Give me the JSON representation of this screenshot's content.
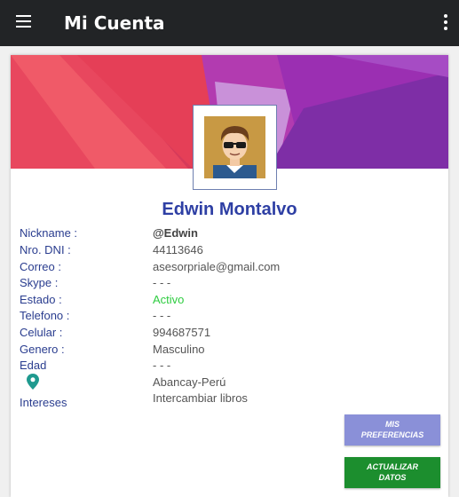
{
  "appbar": {
    "title": "Mi Cuenta",
    "menu_icon": "hamburger-menu-icon",
    "overflow_icon": "more-vertical-icon"
  },
  "profile": {
    "name": "Edwin Montalvo",
    "name_color": "#2e3fa4"
  },
  "fields": [
    {
      "label": "Nickname :",
      "value": "@Edwin"
    },
    {
      "label": "Nro. DNI :",
      "value": "44113646"
    },
    {
      "label": "Correo :",
      "value": "asesorpriale@gmail.com"
    },
    {
      "label": "Skype :",
      "value": "- - -"
    },
    {
      "label": "Estado :",
      "value": "Activo"
    },
    {
      "label": "Telefono :",
      "value": "- - -"
    },
    {
      "label": "Celular :",
      "value": "994687571"
    },
    {
      "label": "Genero :",
      "value": "Masculino"
    },
    {
      "label": "Edad",
      "value": "- - -"
    },
    {
      "label": "",
      "value": "Abancay-Perú",
      "icon": "location-pin-icon"
    },
    {
      "label": "Intereses",
      "value": "Intercambiar libros"
    }
  ],
  "buttons": {
    "preferences": {
      "line1": "MIS",
      "line2": "PREFERENCIAS",
      "color": "#8a90d8"
    },
    "update": {
      "line1": "ACTUALIZAR",
      "line2": "DATOS",
      "color": "#1c8e2e"
    }
  },
  "colors": {
    "appbar": "#222426",
    "label": "#2a3d8f",
    "active_status": "#2ecc40"
  }
}
